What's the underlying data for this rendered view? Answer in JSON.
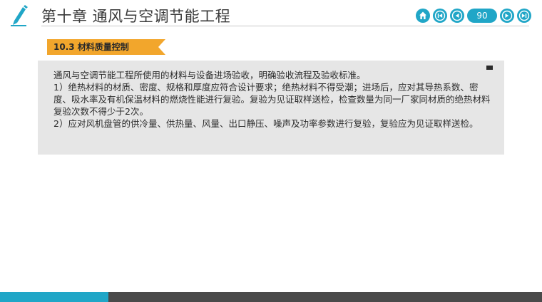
{
  "header": {
    "chapter_title": "第十章 通风与空调节能工程"
  },
  "nav": {
    "page_number": "90",
    "buttons": [
      "home-icon",
      "first-page-icon",
      "previous-page-icon",
      "next-page-icon",
      "last-page-icon"
    ]
  },
  "section": {
    "label": "10.3 材料质量控制"
  },
  "content": {
    "paragraphs": [
      "通风与空调节能工程所使用的材料与设备进场验收，明确验收流程及验收标准。",
      "1）绝热材料的材质、密度、规格和厚度应符合设计要求；绝热材料不得受潮；进场后，应对其导热系数、密度、吸水率及有机保温材料的燃烧性能进行复验。复验为见证取样送检，检查数量为同一厂家同材质的绝热材料复验次数不得少于2次。",
      "2）应对风机盘管的供冷量、供热量、风量、出口静压、噪声及功率参数进行复验，复验应为见证取样送检。"
    ]
  },
  "colors": {
    "accent": "#20a6c7",
    "section_tab": "#f2a62c",
    "content_bg": "#e6e6e6",
    "footer_dark": "#4a4a4a"
  }
}
